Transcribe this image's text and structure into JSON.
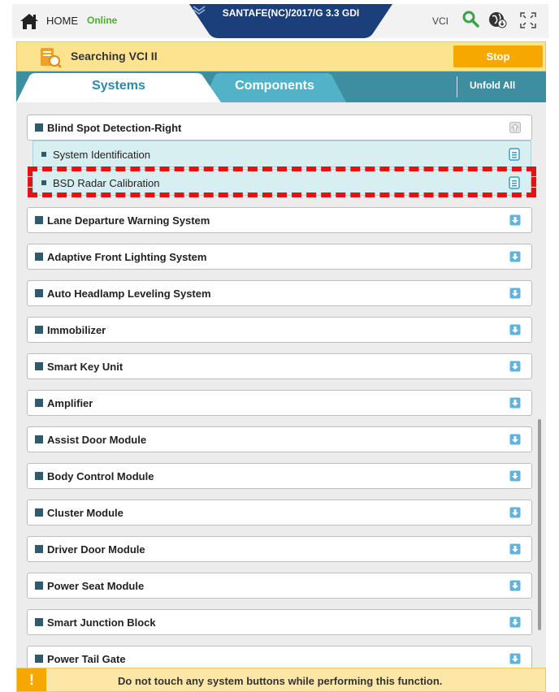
{
  "topbar": {
    "home_label": "HOME",
    "status": "Online",
    "vehicle": "SANTAFE(NC)/2017/G 3.3 GDI",
    "vci_label": "VCI"
  },
  "search_bar": {
    "text": "Searching VCI II",
    "stop_label": "Stop"
  },
  "tabs": {
    "systems": "Systems",
    "components": "Components",
    "unfold_all": "Unfold All"
  },
  "systems": {
    "expanded": "Blind Spot Detection-Right",
    "sub_items": [
      "System Identification",
      "BSD Radar Calibration"
    ],
    "items": [
      "Lane Departure Warning System",
      "Adaptive Front Lighting System",
      "Auto Headlamp Leveling System",
      "Immobilizer",
      "Smart Key Unit",
      "Amplifier",
      "Assist Door Module",
      "Body Control Module",
      "Cluster Module",
      "Driver Door Module",
      "Power Seat Module",
      "Smart Junction Block",
      "Power Tail Gate"
    ]
  },
  "warning": {
    "icon": "!",
    "text": "Do not touch any system buttons while performing this function."
  },
  "colors": {
    "accent_teal": "#3d8ea0",
    "vehicle_tab": "#1b3f7a",
    "stop_orange": "#f6a800",
    "online_green": "#4caf2a",
    "highlight_red": "#e31313"
  }
}
